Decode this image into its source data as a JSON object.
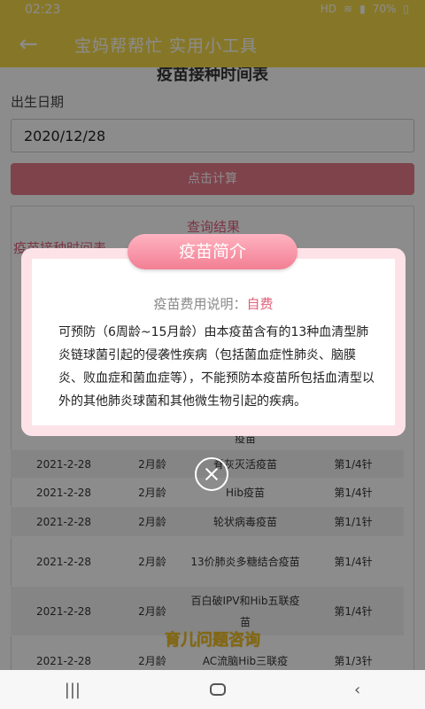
{
  "status": {
    "time": "02:23",
    "battery": "70%",
    "signal_text": "HD"
  },
  "appbar": {
    "back_icon": "arrow-left",
    "title": "宝妈帮帮忙 实用小工具"
  },
  "page": {
    "heading": "疫苗接种时间表",
    "dob_label": "出生日期",
    "dob_value": "2020/12/28",
    "calc_button": "点击计算",
    "result_title": "查询结果",
    "result_sub": "疫苗接种时间表",
    "consult_link": "育儿问题咨询"
  },
  "table": {
    "rows": [
      {
        "date": "",
        "age": "",
        "vaccine": "疫苗",
        "dose": ""
      },
      {
        "date": "2021-2-28",
        "age": "2月龄",
        "vaccine": "脊灰灭活疫苗",
        "dose": "第1/4针"
      },
      {
        "date": "2021-2-28",
        "age": "2月龄",
        "vaccine": "Hib疫苗",
        "dose": "第1/4针"
      },
      {
        "date": "2021-2-28",
        "age": "2月龄",
        "vaccine": "轮状病毒疫苗",
        "dose": "第1/1针"
      },
      {
        "date": "2021-2-28",
        "age": "2月龄",
        "vaccine": "13价肺炎多糖结合疫苗",
        "dose": "第1/4针"
      },
      {
        "date": "2021-2-28",
        "age": "2月龄",
        "vaccine": "百白破IPV和Hib五联疫苗",
        "dose": "第1/4针"
      },
      {
        "date": "2021-2-28",
        "age": "2月龄",
        "vaccine": "AC流脑Hib三联疫",
        "dose": "第1/3针"
      }
    ]
  },
  "modal": {
    "tab_title": "疫苗简介",
    "fee_label": "疫苗费用说明：",
    "fee_value": "自费",
    "description": "可预防（6周龄~15月龄）由本疫苗含有的13种血清型肺炎链球菌引起的侵袭性疾病（包括菌血症性肺炎、脑膜炎、败血症和菌血症等），不能预防本疫苗所包括血清型以外的其他肺炎球菌和其他微生物引起的疾病。"
  },
  "colors": {
    "accent_yellow": "#f5d94a",
    "accent_pink": "#e87a8b",
    "result_pink": "#e0607a"
  }
}
